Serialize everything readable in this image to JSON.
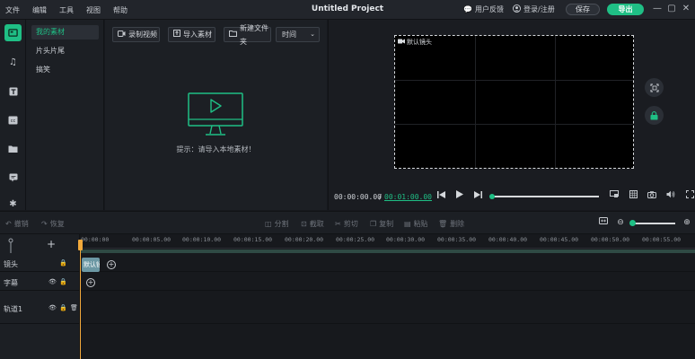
{
  "titlebar": {
    "menus": [
      "文件",
      "编辑",
      "工具",
      "视图",
      "帮助"
    ],
    "project_title": "Untitled Project",
    "feedback": "用户反馈",
    "login": "登录/注册",
    "save": "保存",
    "export": "导出"
  },
  "categories": [
    "我的素材",
    "片头片尾",
    "搞笑"
  ],
  "media": {
    "record": "录制视频",
    "import": "导入素材",
    "new_folder": "新建文件夹",
    "sort": "时间",
    "empty_hint": "提示：请导入本地素材！"
  },
  "preview": {
    "camera_label": "默认镜头",
    "current_time": "00:00:00.00",
    "separator": "/",
    "total_time": "00:01:00.00",
    "progress": 0
  },
  "timeline_toolbar": {
    "undo": "撤销",
    "redo": "恢复",
    "split": "分割",
    "crop": "截取",
    "cut": "剪切",
    "copy": "复制",
    "paste": "粘贴",
    "delete": "删除"
  },
  "timeline": {
    "ruler": [
      "00:00:00",
      "00:00:05.00",
      "00:00:10.00",
      "00:00:15.00",
      "00:00:20.00",
      "00:00:25.00",
      "00:00:30.00",
      "00:00:35.00",
      "00:00:40.00",
      "00:00:45.00",
      "00:00:50.00",
      "00:00:55.00"
    ],
    "tracks": [
      "镜头",
      "字幕",
      "轨道1"
    ],
    "clip_label": "默认镜头"
  },
  "colors": {
    "accent": "#1fbf85",
    "playhead": "#f2a93b",
    "clip": "#6c98a4"
  }
}
